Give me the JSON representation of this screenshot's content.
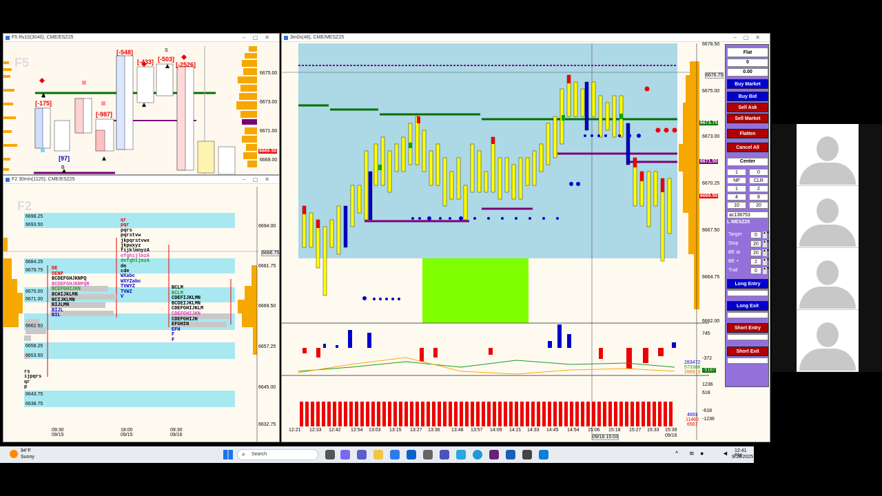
{
  "win_f5": {
    "title": "F5 Rv10(3040), CME/ESZ25",
    "label": "F5",
    "prices": [
      "6675.00",
      "6673.00",
      "6671.00",
      "6669.00"
    ],
    "current_price": "6669.50",
    "deltas": [
      "[-548]",
      "[-433]",
      "[-503]",
      "[-2526]",
      "[-175]",
      "[-987]",
      "[97]"
    ]
  },
  "win_f2": {
    "title": "F2 30min(1125), CME/ESZ25",
    "label": "F2",
    "levels": [
      "6698.25",
      "6693.50",
      "6684.25",
      "6679.75",
      "6675.00",
      "6671.00",
      "6662.50",
      "6658.25",
      "6653.50",
      "6643.75",
      "6638.75"
    ],
    "prices": [
      "6694.00",
      "6681.75",
      "6669.50",
      "6657.25",
      "6645.00",
      "6632.75"
    ],
    "axis_price_label": "6686.75",
    "times": [
      "09:30",
      "18:00",
      "09:30"
    ],
    "dates": [
      "09/15",
      "09/15",
      "09/16"
    ],
    "letters": [
      "DE",
      "DENP",
      "BCDEFGHJKNPQ",
      "BCDEFGHJKNPQR",
      "BCEFGHIJKN",
      "BCHIJKLMN",
      "BCIJKLMN",
      "BIJLMN",
      "BIJL",
      "BIL"
    ],
    "profile_top": [
      "qr",
      "pqr",
      "pqrs",
      "pqrstvw",
      "jkpqrstvwx",
      "jkpwxyz",
      "fijklmnyzA",
      "efghijlmzA",
      "defghijmzA"
    ],
    "profile_mid": [
      "de",
      "cde",
      "WXabc",
      "WXYZabc",
      "TVWYZ",
      "TVWZ",
      "V"
    ],
    "profile_bottom": [
      "rs",
      "ijpqrs",
      "qr",
      "p"
    ],
    "profile_right": [
      "BCLM",
      "BCLM",
      "CDEFIJKLMN",
      "BCDEIJKLMN",
      "CDEFGHIJKLM",
      "CDEFGHIJKN",
      "CDEFGHIJN",
      "EFGHIN",
      "EFH",
      "F",
      "F"
    ]
  },
  "win_main": {
    "title": "3m0s(48), CME/MESZ25",
    "prices": [
      "6676.75",
      "6675.00",
      "6673.00",
      "6670.25",
      "6667.50",
      "6664.75",
      "6662.00"
    ],
    "price_top": "6678.50",
    "current_price": "6669.50",
    "green_price": "6673.75",
    "purple_price": "6671.50",
    "times": [
      "12:21",
      "12:33",
      "12:42",
      "12:54",
      "13:03",
      "13:15",
      "13:27",
      "13:36",
      "13:48",
      "13:57",
      "14:09",
      "14:21",
      "14:33",
      "14:45",
      "14:54",
      "15:06",
      "15:18",
      "15:27",
      "15:33",
      "15:39"
    ],
    "crosshair_time": "09/16 15:03",
    "date_end": "09/16",
    "delta_axis": [
      "745",
      "-372"
    ],
    "delta_values": [
      "283472",
      "573388",
      "288919",
      "-5187",
      "-5187"
    ],
    "vol_axis": [
      "1236",
      "618",
      "-618",
      "-1236"
    ],
    "vol_values": [
      "4893",
      "11460",
      "6567"
    ]
  },
  "trade_panel": {
    "status": "Flat",
    "position": "0",
    "pnl": "0.00",
    "buttons": [
      "Buy Market",
      "Buy Bid",
      "Sell Ask",
      "Sell Market",
      "Flatten",
      "Cancel All"
    ],
    "center_label": "Center",
    "qty_grid": [
      "1",
      "0",
      "NP",
      "CLR",
      "1",
      "2",
      "4",
      "8",
      "10",
      "20"
    ],
    "account": "ac138753",
    "instrument": "L MESZ25",
    "fields": [
      {
        "label": "Target",
        "value": "0"
      },
      {
        "label": "Stop",
        "value": "20"
      },
      {
        "label": "BE at",
        "value": "20"
      },
      {
        "label": "BE +",
        "value": "2"
      },
      {
        "label": "Trail",
        "value": "0"
      }
    ],
    "entries": [
      "Long Entry",
      "Long Exit",
      "Short Entry",
      "Short Exit"
    ]
  },
  "taskbar": {
    "weather_temp": "94°F",
    "weather_desc": "Sunny",
    "search_placeholder": "Search",
    "time": "12:41 PM",
    "date": "9/16/2025"
  },
  "colors": {
    "buy": "#0000cc",
    "sell": "#b00000",
    "panel_bg": "#9370db",
    "chart_bg": "#add8e6"
  }
}
